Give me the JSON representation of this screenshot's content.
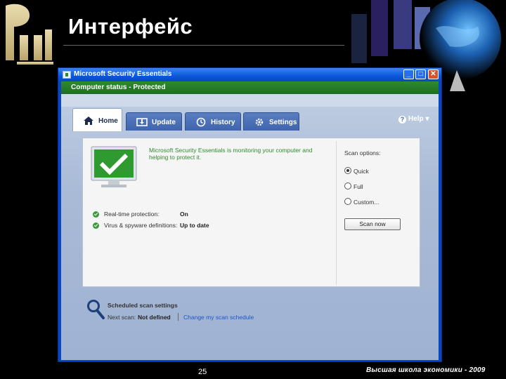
{
  "slide": {
    "title": "Интерфейс",
    "page_number": "25",
    "footer": "Высшая школа экономики - 2009"
  },
  "window": {
    "title": "Microsoft Security Essentials",
    "status": "Computer status - Protected",
    "controls": {
      "minimize": "_",
      "maximize": "□",
      "close": "✕"
    }
  },
  "tabs": [
    {
      "label": "Home",
      "icon": "house-icon",
      "active": true
    },
    {
      "label": "Update",
      "icon": "update-icon",
      "active": false
    },
    {
      "label": "History",
      "icon": "history-icon",
      "active": false
    },
    {
      "label": "Settings",
      "icon": "gear-icon",
      "active": false
    }
  ],
  "help": {
    "label": "Help ▾",
    "icon": "question-icon"
  },
  "home": {
    "message": "Microsoft Security Essentials is monitoring your computer and helping to protect it.",
    "rows": [
      {
        "label": "Real-time protection:",
        "value": "On"
      },
      {
        "label": "Virus & spyware definitions:",
        "value": "Up to date"
      }
    ],
    "scan_options": {
      "title": "Scan options:",
      "options": [
        "Quick",
        "Full",
        "Custom..."
      ],
      "selected": "Quick",
      "button": "Scan now"
    }
  },
  "scheduled": {
    "title": "Scheduled scan settings",
    "next_label": "Next scan:",
    "next_value": "Not defined",
    "link": "Change my scan schedule"
  },
  "colors": {
    "window_blue": "#0a46c4",
    "status_green": "#2f8a2f",
    "message_green": "#2f8a2f",
    "link_blue": "#1a56c9"
  }
}
